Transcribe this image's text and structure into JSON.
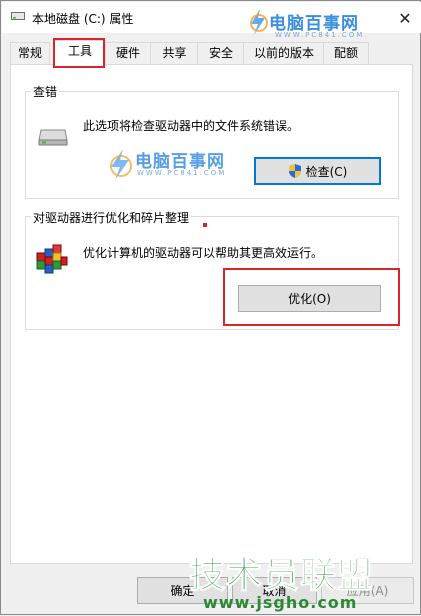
{
  "window": {
    "title": "本地磁盘 (C:) 属性"
  },
  "tabs": [
    {
      "label": "常规"
    },
    {
      "label": "工具"
    },
    {
      "label": "硬件"
    },
    {
      "label": "共享"
    },
    {
      "label": "安全"
    },
    {
      "label": "以前的版本"
    },
    {
      "label": "配额"
    }
  ],
  "error_check": {
    "group_title": "查错",
    "description": "此选项将检查驱动器中的文件系统错误。",
    "button_label": "检查(C)"
  },
  "optimize": {
    "group_title": "对驱动器进行优化和碎片整理",
    "description": "优化计算机的驱动器可以帮助其更高效运行。",
    "button_label": "优化(O)"
  },
  "footer": {
    "ok_label": "确定",
    "cancel_label": "取消",
    "apply_label": "应用(A)"
  },
  "watermarks": {
    "brand": "电脑百事网",
    "brand_url": "WWW.PC841.COM",
    "site": "技术员联盟",
    "site_url": "www.jsgho.com"
  },
  "colors": {
    "highlight": "#d6262b",
    "focus": "#0078d7",
    "brand_blue": "#3b8ee0",
    "site_green": "#2a9a3a"
  }
}
